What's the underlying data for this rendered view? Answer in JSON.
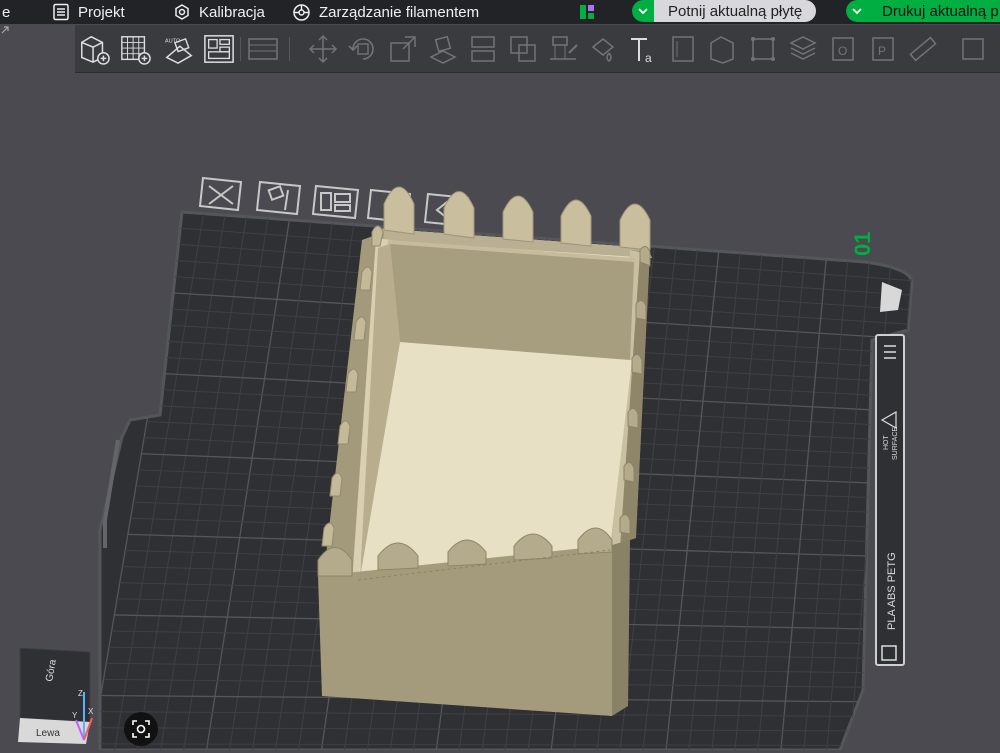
{
  "menu": {
    "partial_label": "e",
    "project_label": "Projekt",
    "calibration_label": "Kalibracja",
    "filament_label": "Zarządzanie filamentem"
  },
  "actions": {
    "slice_label": "Potnij aktualną płytę",
    "print_label": "Drukuj aktualną p"
  },
  "plate": {
    "number": "01",
    "hot_surface_line1": "HOT",
    "hot_surface_line2": "SURFACE",
    "materials": "PLA ABS PETG"
  },
  "view_cube": {
    "top_face": "Góra",
    "left_face": "Lewa",
    "axis_z": "Z",
    "axis_x": "X",
    "axis_y": "Y"
  },
  "colors": {
    "accent": "#00ae42",
    "background": "#4a4a50",
    "model": "#cfc5a3",
    "bed": "#2f3034"
  },
  "toolbar_icons": [
    "add-object-icon",
    "add-plate-icon",
    "auto-orient-icon",
    "arrange-icon",
    "split-list-icon",
    "move-icon",
    "rotate-icon",
    "scale-icon",
    "lay-on-face-icon",
    "cut-icon",
    "mesh-boolean-icon",
    "support-paint-icon",
    "seam-paint-icon",
    "text-icon",
    "variable-layer-icon",
    "split-objects-icon",
    "split-parts-icon",
    "layers-icon",
    "view-object-icon",
    "view-plate-icon",
    "measure-icon"
  ],
  "plate_icons": [
    "delete-plate-icon",
    "auto-orient-plate-icon",
    "arrange-plate-icon",
    "lock-plate-icon",
    "plate-settings-icon"
  ]
}
